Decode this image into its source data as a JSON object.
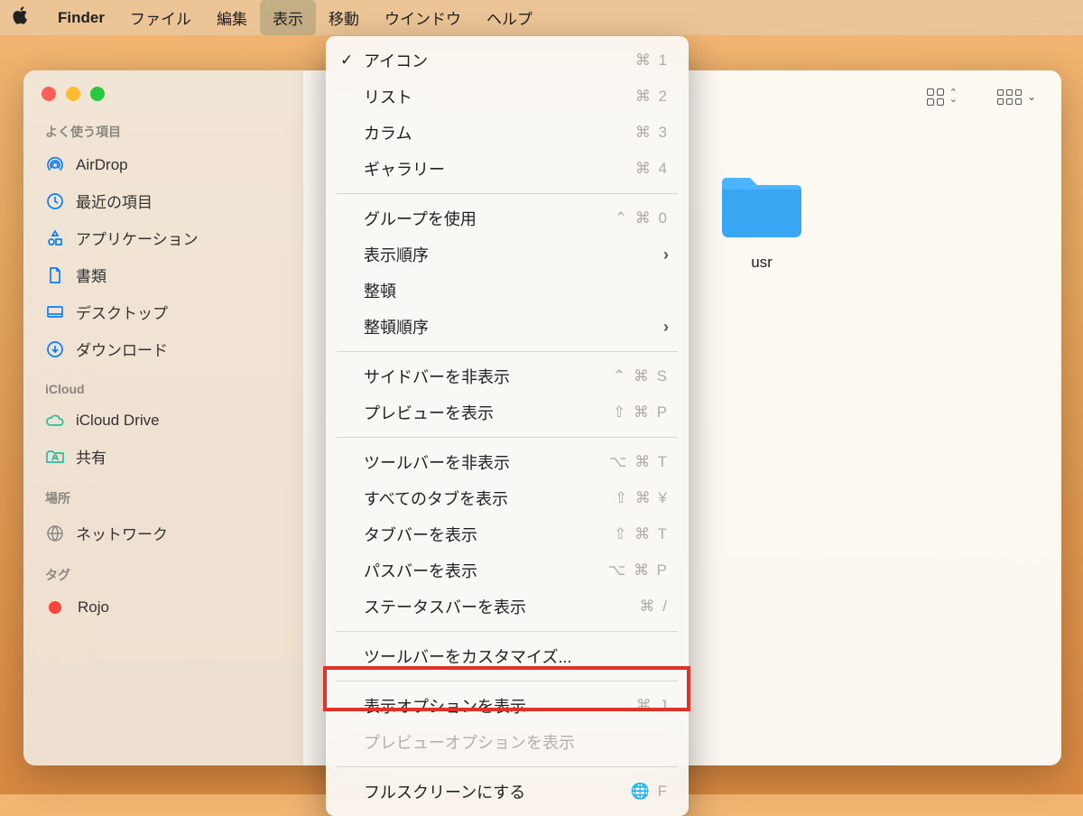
{
  "menubar": {
    "app": "Finder",
    "items": [
      "ファイル",
      "編集",
      "表示",
      "移動",
      "ウインドウ",
      "ヘルプ"
    ],
    "active_index": 2
  },
  "sidebar": {
    "favorites_header": "よく使う項目",
    "favorites": [
      {
        "icon": "airdrop",
        "label": "AirDrop"
      },
      {
        "icon": "clock",
        "label": "最近の項目"
      },
      {
        "icon": "apps",
        "label": "アプリケーション"
      },
      {
        "icon": "doc",
        "label": "書類"
      },
      {
        "icon": "desktop",
        "label": "デスクトップ"
      },
      {
        "icon": "download",
        "label": "ダウンロード"
      }
    ],
    "icloud_header": "iCloud",
    "icloud": [
      {
        "icon": "cloud",
        "label": "iCloud Drive"
      },
      {
        "icon": "shared",
        "label": "共有"
      }
    ],
    "locations_header": "場所",
    "locations": [
      {
        "icon": "globe",
        "label": "ネットワーク"
      }
    ],
    "tags_header": "タグ",
    "tags": [
      {
        "color": "#ff453a",
        "label": "Rojo"
      }
    ]
  },
  "content": {
    "folder_name": "usr"
  },
  "menu": {
    "group1": [
      {
        "checked": true,
        "label": "アイコン",
        "shortcut": "⌘ 1"
      },
      {
        "checked": false,
        "label": "リスト",
        "shortcut": "⌘ 2"
      },
      {
        "checked": false,
        "label": "カラム",
        "shortcut": "⌘ 3"
      },
      {
        "checked": false,
        "label": "ギャラリー",
        "shortcut": "⌘ 4"
      }
    ],
    "group2": [
      {
        "label": "グループを使用",
        "shortcut": "⌃ ⌘ 0"
      },
      {
        "label": "表示順序",
        "submenu": true
      },
      {
        "label": "整頓"
      },
      {
        "label": "整頓順序",
        "submenu": true
      }
    ],
    "group3": [
      {
        "label": "サイドバーを非表示",
        "shortcut": "⌃ ⌘ S"
      },
      {
        "label": "プレビューを表示",
        "shortcut": "⇧ ⌘ P"
      }
    ],
    "group4": [
      {
        "label": "ツールバーを非表示",
        "shortcut": "⌥ ⌘ T"
      },
      {
        "label": "すべてのタブを表示",
        "shortcut": "⇧ ⌘ ¥"
      },
      {
        "label": "タブバーを表示",
        "shortcut": "⇧ ⌘ T"
      },
      {
        "label": "パスバーを表示",
        "shortcut": "⌥ ⌘ P"
      },
      {
        "label": "ステータスバーを表示",
        "shortcut": "⌘ /"
      }
    ],
    "group5": [
      {
        "label": "ツールバーをカスタマイズ..."
      }
    ],
    "group6": [
      {
        "label": "表示オプションを表示",
        "shortcut": "⌘ J"
      },
      {
        "label": "プレビューオプションを表示",
        "disabled": true
      }
    ],
    "group7": [
      {
        "label": "フルスクリーンにする",
        "shortcut": "🌐 F"
      }
    ]
  }
}
